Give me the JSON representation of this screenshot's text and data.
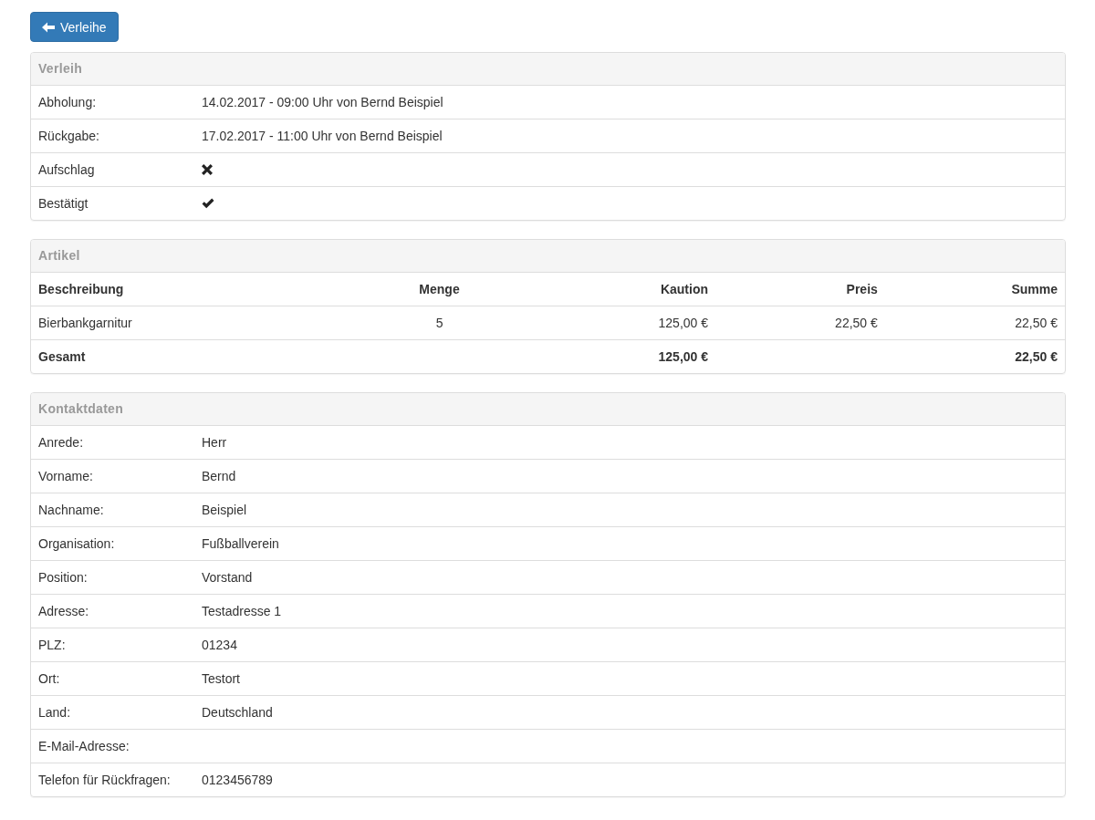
{
  "back_button": {
    "label": "Verleihe"
  },
  "rental": {
    "title": "Verleih",
    "rows": [
      {
        "kind": "text",
        "label": "Abholung:",
        "value": "14.02.2017 - 09:00 Uhr von Bernd Beispiel"
      },
      {
        "kind": "text",
        "label": "Rückgabe:",
        "value": "17.02.2017 - 11:00 Uhr von Bernd Beispiel"
      },
      {
        "kind": "flag",
        "label": "Aufschlag",
        "checked": false
      },
      {
        "kind": "flag",
        "label": "Bestätigt",
        "checked": true
      }
    ]
  },
  "articles": {
    "title": "Artikel",
    "columns": [
      {
        "label": "Beschreibung"
      },
      {
        "label": "Menge"
      },
      {
        "label": "Kaution"
      },
      {
        "label": "Preis"
      },
      {
        "label": "Summe"
      }
    ],
    "rows": [
      {
        "cells": [
          "Bierbankgarnitur",
          "5",
          "125,00 €",
          "22,50 €",
          "22,50 €"
        ]
      }
    ],
    "total": {
      "cells": [
        "Gesamt",
        "",
        "125,00 €",
        "",
        "22,50 €"
      ]
    }
  },
  "contact": {
    "title": "Kontaktdaten",
    "rows": [
      {
        "kind": "text",
        "label": "Anrede:",
        "value": "Herr"
      },
      {
        "kind": "text",
        "label": "Vorname:",
        "value": "Bernd"
      },
      {
        "kind": "text",
        "label": "Nachname:",
        "value": "Beispiel"
      },
      {
        "kind": "text",
        "label": "Organisation:",
        "value": "Fußballverein"
      },
      {
        "kind": "text",
        "label": "Position:",
        "value": "Vorstand"
      },
      {
        "kind": "text",
        "label": "Adresse:",
        "value": "Testadresse 1"
      },
      {
        "kind": "text",
        "label": "PLZ:",
        "value": "01234"
      },
      {
        "kind": "text",
        "label": "Ort:",
        "value": "Testort"
      },
      {
        "kind": "text",
        "label": "Land:",
        "value": "Deutschland"
      },
      {
        "kind": "text",
        "label": "E-Mail-Adresse:"
      },
      {
        "kind": "text",
        "label": "Telefon für Rückfragen:",
        "value": "0123456789"
      }
    ]
  }
}
